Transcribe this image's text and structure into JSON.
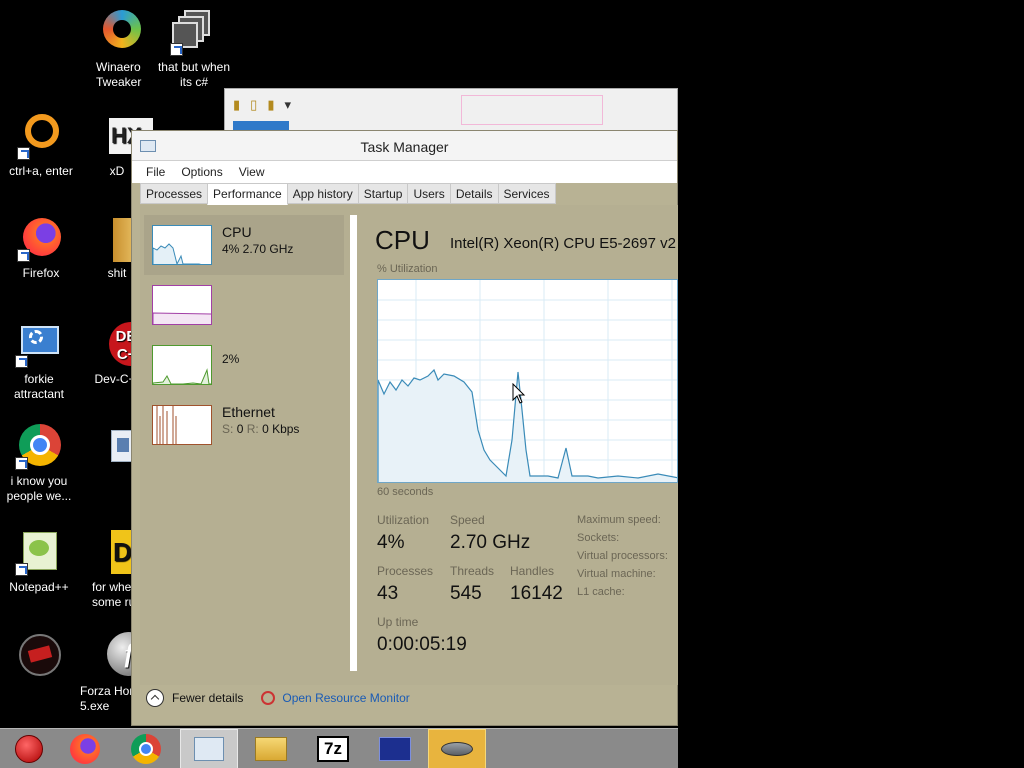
{
  "desktop": {
    "icons": [
      {
        "id": "winaero",
        "label": "Winaero\nTweaker"
      },
      {
        "id": "csharp",
        "label": "that but when\nits c#"
      },
      {
        "id": "ctrla",
        "label": "ctrl+a, enter"
      },
      {
        "id": "xd",
        "label": "xD"
      },
      {
        "id": "firefox",
        "label": "Firefox"
      },
      {
        "id": "shit",
        "label": "shit"
      },
      {
        "id": "forkie",
        "label": "forkie\nattractant"
      },
      {
        "id": "devcpp",
        "label": "Dev-C+"
      },
      {
        "id": "chrome",
        "label": "i know you\npeople we..."
      },
      {
        "id": "window",
        "label": ""
      },
      {
        "id": "notepadpp",
        "label": "Notepad++"
      },
      {
        "id": "forwhe",
        "label": "for whe\nsome rus"
      },
      {
        "id": "redcircle",
        "label": ""
      },
      {
        "id": "forza",
        "label": "Forza Hor\n5.exe"
      }
    ]
  },
  "task_manager": {
    "title": "Task Manager",
    "menu": [
      "File",
      "Options",
      "View"
    ],
    "tabs": [
      "Processes",
      "Performance",
      "App history",
      "Startup",
      "Users",
      "Details",
      "Services"
    ],
    "active_tab": "Performance",
    "sidebar": {
      "cpu": {
        "name": "CPU",
        "detail": "4%  2.70 GHz"
      },
      "memory": {
        "name": "",
        "detail": ""
      },
      "disk": {
        "name": "",
        "detail": "2%"
      },
      "ethernet": {
        "name": "Ethernet",
        "s_label": "S:",
        "s_val": "0",
        "r_label": "R:",
        "r_val": "0 Kbps"
      }
    },
    "panel": {
      "title": "CPU",
      "model": "Intel(R) Xeon(R) CPU E5-2697 v2",
      "graph_top_label": "% Utilization",
      "graph_bottom_label": "60 seconds",
      "utilization_label": "Utilization",
      "utilization_value": "4%",
      "speed_label": "Speed",
      "speed_value": "2.70 GHz",
      "processes_label": "Processes",
      "processes_value": "43",
      "threads_label": "Threads",
      "threads_value": "545",
      "handles_label": "Handles",
      "handles_value": "16142",
      "uptime_label": "Up time",
      "uptime_value": "0:00:05:19",
      "specs": [
        "Maximum speed:",
        "Sockets:",
        "Virtual processors:",
        "Virtual machine:",
        "L1 cache:"
      ]
    },
    "footer": {
      "fewer_details": "Fewer details",
      "resource_monitor": "Open Resource Monitor"
    }
  },
  "taskbar": {
    "items": [
      "ornament",
      "firefox",
      "chrome",
      "task-manager",
      "file-explorer",
      "7z",
      "blue-window",
      "fish-app"
    ],
    "text_7z": "7z"
  },
  "colors": {
    "cpu_line": "#3a8bb8",
    "memory_line": "#a23fa6",
    "disk_line": "#4f9a2f",
    "ethernet_line": "#a0522d"
  }
}
